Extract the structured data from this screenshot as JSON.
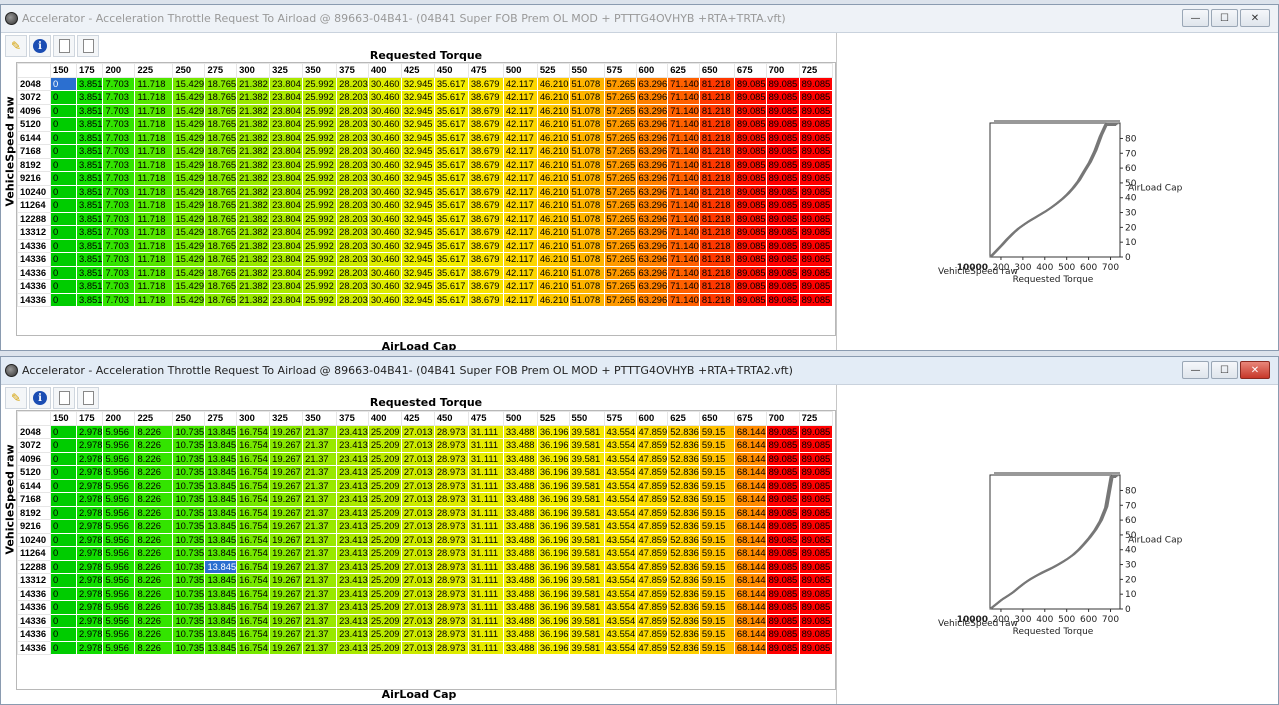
{
  "window1": {
    "title": "Accelerator - Acceleration Throttle Request To Airload @ 89663-04B41- (04B41 Super FOB Prem OL MOD + PTTTG4OVHYB +RTA+TRTA.vft)",
    "x_axis_label": "Requested Torque",
    "y_axis_label": "VehicleSpeed raw",
    "z_axis_label": "AirLoad Cap",
    "selected_cell": "0",
    "columns": [
      "150",
      "175",
      "200",
      "225",
      "250",
      "275",
      "300",
      "325",
      "350",
      "375",
      "400",
      "425",
      "450",
      "475",
      "500",
      "525",
      "550",
      "575",
      "600",
      "625",
      "650",
      "675",
      "700",
      "725"
    ],
    "rows": [
      "2048",
      "3072",
      "4096",
      "5120",
      "6144",
      "7168",
      "8192",
      "9216",
      "10240",
      "11264",
      "12288",
      "13312",
      "14336",
      "14336",
      "14336",
      "14336",
      "14336"
    ],
    "row_values": [
      "0",
      "3.851",
      "7.703",
      "11.718",
      "15.429",
      "18.765",
      "21.382",
      "23.804",
      "25.992",
      "28.203",
      "30.460",
      "32.945",
      "35.617",
      "38.679",
      "42.117",
      "46.210",
      "51.078",
      "57.265",
      "63.296",
      "71.140",
      "81.218",
      "89.085",
      "89.085",
      "89.085"
    ],
    "cell_colors": [
      "#00cc00",
      "#11dd00",
      "#33e400",
      "#55e600",
      "#77e800",
      "#88e800",
      "#99e800",
      "#aae900",
      "#bbea00",
      "#ccea00",
      "#ddeb00",
      "#eaec00",
      "#f2ec00",
      "#f8e200",
      "#fcd600",
      "#ffc800",
      "#ffb400",
      "#ff9a00",
      "#ff8000",
      "#ff6000",
      "#ff3800",
      "#ff1000",
      "#ff0000",
      "#ff0000"
    ],
    "chart": {
      "x_label": "Requested Torque",
      "z_label": "AirLoad Cap",
      "y_label": "VehicleSpeed raw",
      "y_tick_overlap": "10000",
      "x_ticks": [
        "200",
        "300",
        "400",
        "500",
        "600",
        "700"
      ],
      "z_ticks": [
        "0",
        "10",
        "20",
        "30",
        "40",
        "50",
        "60",
        "70",
        "80"
      ]
    }
  },
  "window2": {
    "title": "Accelerator - Acceleration Throttle Request To Airload @ 89663-04B41- (04B41 Super FOB Prem OL MOD + PTTTG4OVHYB +RTA+TRTA2.vft)",
    "x_axis_label": "Requested Torque",
    "y_axis_label": "VehicleSpeed raw",
    "z_axis_label": "AirLoad Cap",
    "selected_cell": "13.845",
    "columns": [
      "150",
      "175",
      "200",
      "225",
      "250",
      "275",
      "300",
      "325",
      "350",
      "375",
      "400",
      "425",
      "450",
      "475",
      "500",
      "525",
      "550",
      "575",
      "600",
      "625",
      "650",
      "675",
      "700",
      "725"
    ],
    "rows": [
      "2048",
      "3072",
      "4096",
      "5120",
      "6144",
      "7168",
      "8192",
      "9216",
      "10240",
      "11264",
      "12288",
      "13312",
      "14336",
      "14336",
      "14336",
      "14336",
      "14336"
    ],
    "row_values": [
      "0",
      "2.978",
      "5.956",
      "8.226",
      "10.735",
      "13.845",
      "16.754",
      "19.267",
      "21.37",
      "23.413",
      "25.209",
      "27.013",
      "28.973",
      "31.111",
      "33.488",
      "36.196",
      "39.581",
      "43.554",
      "47.859",
      "52.836",
      "59.15",
      "68.144",
      "89.085",
      "89.085"
    ],
    "cell_colors": [
      "#00cc00",
      "#11dd00",
      "#22e200",
      "#33e400",
      "#44e500",
      "#55e600",
      "#77e800",
      "#88e800",
      "#99e800",
      "#aae900",
      "#bbea00",
      "#ccea00",
      "#ddeb00",
      "#e6ec00",
      "#eeec00",
      "#f2ec00",
      "#f6e800",
      "#fae400",
      "#fcdc00",
      "#ffd000",
      "#ffc000",
      "#ff8a00",
      "#ff0000",
      "#ff0000"
    ],
    "chart": {
      "x_label": "Requested Torque",
      "z_label": "AirLoad Cap",
      "y_label": "VehicleSpeed raw",
      "y_tick_overlap": "10000",
      "x_ticks": [
        "200",
        "300",
        "400",
        "500",
        "600",
        "700"
      ],
      "z_ticks": [
        "0",
        "10",
        "20",
        "30",
        "40",
        "50",
        "60",
        "70",
        "80"
      ]
    }
  },
  "window_buttons": {
    "minimize": "—",
    "maximize": "☐",
    "close": "✕"
  },
  "toolbar": {
    "pin": "✎",
    "info": "i"
  }
}
